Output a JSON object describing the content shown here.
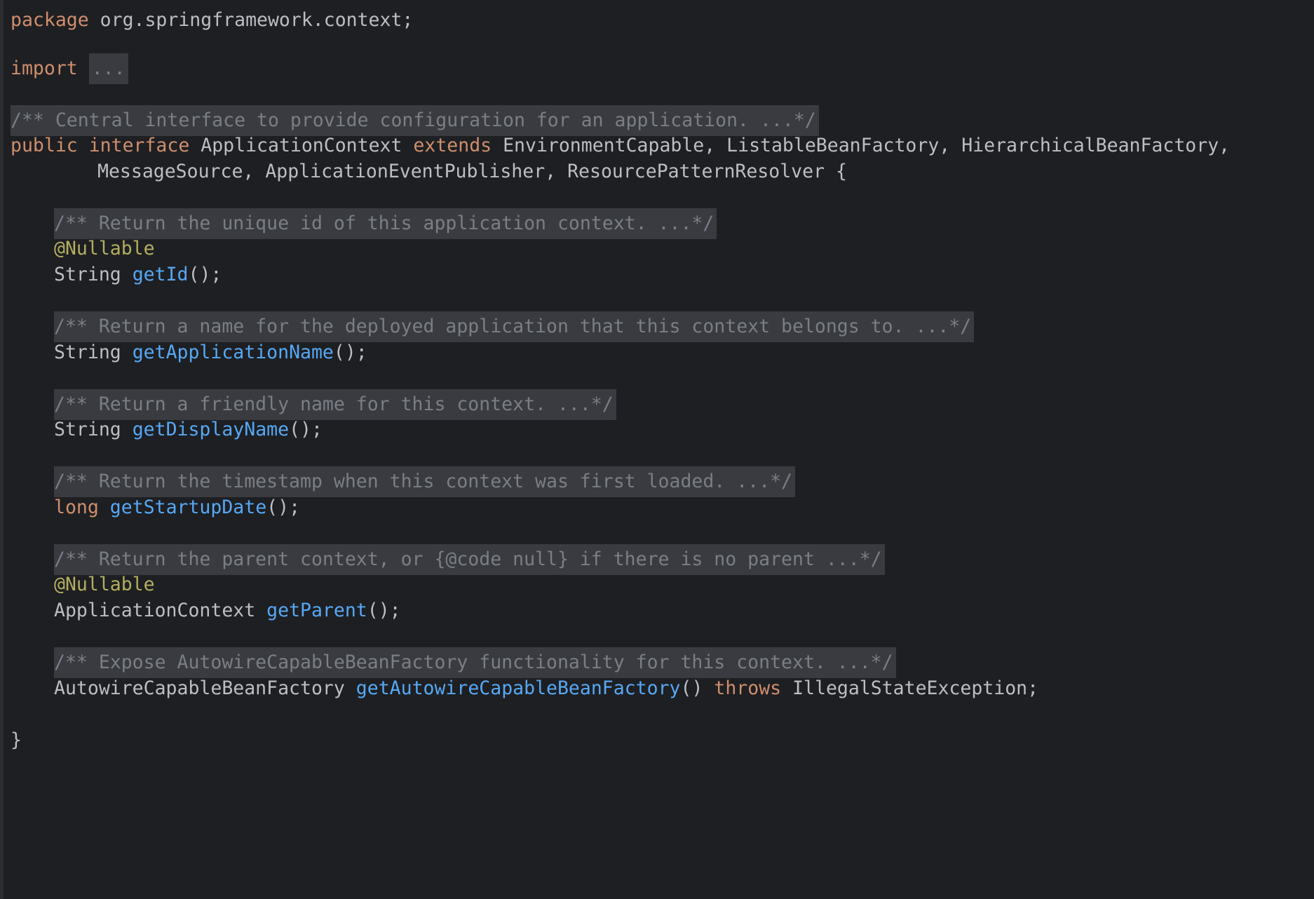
{
  "editor": {
    "package_kw": "package",
    "package_name": "org.springframework.context;",
    "import_kw": "import",
    "import_fold": "...",
    "class_doc": "/** Central interface to provide configuration for an application. ...*/",
    "decl_public": "public",
    "decl_interface": "interface",
    "decl_name": "ApplicationContext",
    "decl_extends": "extends",
    "decl_types_1": "EnvironmentCapable, ListableBeanFactory, HierarchicalBeanFactory,",
    "decl_types_2": "MessageSource, ApplicationEventPublisher, ResourcePatternResolver {",
    "members": [
      {
        "doc": "/** Return the unique id of this application context. ...*/",
        "annotation": "@Nullable",
        "type": "String",
        "method": "getId",
        "suffix": "();"
      },
      {
        "doc": "/** Return a name for the deployed application that this context belongs to. ...*/",
        "type": "String",
        "method": "getApplicationName",
        "suffix": "();"
      },
      {
        "doc": "/** Return a friendly name for this context. ...*/",
        "type": "String",
        "method": "getDisplayName",
        "suffix": "();"
      },
      {
        "doc": "/** Return the timestamp when this context was first loaded. ...*/",
        "type": "long",
        "method": "getStartupDate",
        "suffix": "();"
      },
      {
        "doc": "/** Return the parent context, or {@code null} if there is no parent ...*/",
        "annotation": "@Nullable",
        "type": "ApplicationContext",
        "method": "getParent",
        "suffix": "();"
      },
      {
        "doc": "/** Expose AutowireCapableBeanFactory functionality for this context. ...*/",
        "type": "AutowireCapableBeanFactory",
        "method": "getAutowireCapableBeanFactory",
        "parens": "()",
        "throws_kw": "throws",
        "exception": "IllegalStateException;"
      }
    ],
    "closing_brace": "}"
  },
  "colors": {
    "background": "#1e1f22",
    "keyword": "#cf8e6d",
    "method": "#56a8f5",
    "annotation": "#b3ae60",
    "comment": "#7a7e85",
    "comment_bg": "#393b40",
    "text": "#bcbec4"
  }
}
